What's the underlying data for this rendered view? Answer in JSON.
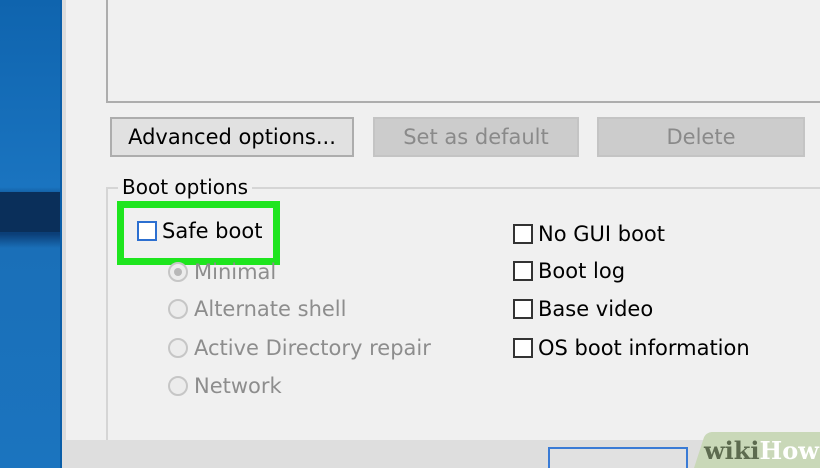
{
  "buttons": {
    "advanced_options": "Advanced options...",
    "set_as_default": "Set as default",
    "delete": "Delete"
  },
  "boot_options": {
    "group_label": "Boot options",
    "safe_boot": {
      "label": "Safe boot",
      "checked": false
    },
    "safe_boot_modes": [
      {
        "label": "Minimal",
        "selected": true,
        "enabled": false
      },
      {
        "label": "Alternate shell",
        "selected": false,
        "enabled": false
      },
      {
        "label": "Active Directory repair",
        "selected": false,
        "enabled": false
      },
      {
        "label": "Network",
        "selected": false,
        "enabled": false
      }
    ],
    "right_options": [
      {
        "label": "No GUI boot",
        "checked": false
      },
      {
        "label": "Boot log",
        "checked": false
      },
      {
        "label": "Base video",
        "checked": false
      },
      {
        "label": "OS boot information",
        "checked": false
      }
    ]
  },
  "highlight_color": "#1ee51e",
  "watermark": {
    "wiki": "wiki",
    "how": "How"
  }
}
